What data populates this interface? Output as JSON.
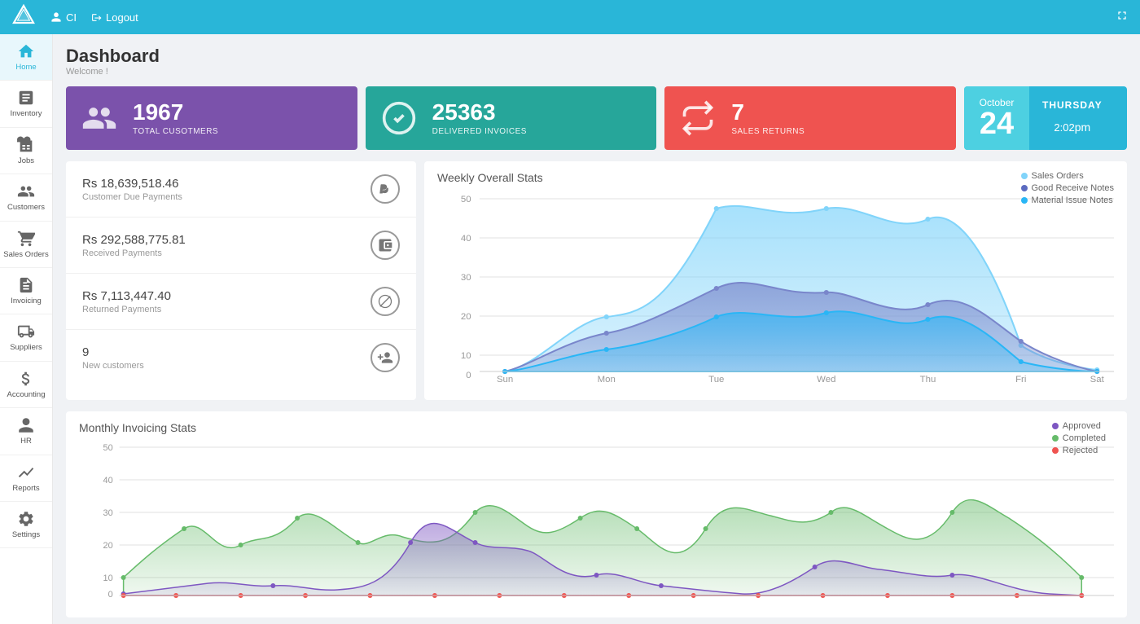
{
  "topNav": {
    "userLabel": "CI",
    "logoutLabel": "Logout",
    "logoAlt": "logo"
  },
  "sidebar": {
    "items": [
      {
        "id": "home",
        "label": "Home",
        "active": true
      },
      {
        "id": "inventory",
        "label": "Inventory",
        "active": false
      },
      {
        "id": "jobs",
        "label": "Jobs",
        "active": false
      },
      {
        "id": "customers",
        "label": "Customers",
        "active": false
      },
      {
        "id": "sales-orders",
        "label": "Sales Orders",
        "active": false
      },
      {
        "id": "invoicing",
        "label": "Invoicing",
        "active": false
      },
      {
        "id": "suppliers",
        "label": "Suppliers",
        "active": false
      },
      {
        "id": "accounting",
        "label": "Accounting",
        "active": false
      },
      {
        "id": "hr",
        "label": "HR",
        "active": false
      },
      {
        "id": "reports",
        "label": "Reports",
        "active": false
      },
      {
        "id": "settings",
        "label": "Settings",
        "active": false
      }
    ]
  },
  "header": {
    "title": "Dashboard",
    "subtitle": "Welcome !"
  },
  "statCards": [
    {
      "id": "customers",
      "number": "1967",
      "label": "TOTAL CUSOTMERS",
      "color": "purple"
    },
    {
      "id": "invoices",
      "number": "25363",
      "label": "DELIVERED INVOICES",
      "color": "teal"
    },
    {
      "id": "returns",
      "number": "7",
      "label": "SALES RETURNS",
      "color": "red"
    }
  ],
  "dateCard": {
    "month": "October",
    "day": "24",
    "weekday": "THURSDAY",
    "time": "2:02",
    "ampm": "pm"
  },
  "payments": [
    {
      "amount": "Rs 18,639,518.46",
      "label": "Customer Due Payments",
      "icon": "paypal"
    },
    {
      "amount": "Rs 292,588,775.81",
      "label": "Received Payments",
      "icon": "wallet"
    },
    {
      "amount": "Rs 7,113,447.40",
      "label": "Returned Payments",
      "icon": "blocked"
    },
    {
      "count": "9",
      "label": "New customers",
      "icon": "add-user"
    }
  ],
  "weeklyChart": {
    "title": "Weekly Overall Stats",
    "yMax": 50,
    "yLabels": [
      50,
      40,
      30,
      20,
      10,
      0
    ],
    "xLabels": [
      "Sun",
      "Mon",
      "Tue",
      "Wed",
      "Thu",
      "Fri",
      "Sat"
    ],
    "legend": [
      {
        "label": "Sales Orders",
        "color": "#81d4fa"
      },
      {
        "label": "Good Receive Notes",
        "color": "#5c6bc0"
      },
      {
        "label": "Material Issue Notes",
        "color": "#29b6f6"
      }
    ]
  },
  "monthlyChart": {
    "title": "Monthly Invoicing Stats",
    "yMax": 50,
    "yLabels": [
      50,
      40,
      30,
      20,
      10,
      0
    ],
    "legend": [
      {
        "label": "Approved",
        "color": "#7e57c2"
      },
      {
        "label": "Completed",
        "color": "#66bb6a"
      },
      {
        "label": "Rejected",
        "color": "#ef5350"
      }
    ]
  }
}
